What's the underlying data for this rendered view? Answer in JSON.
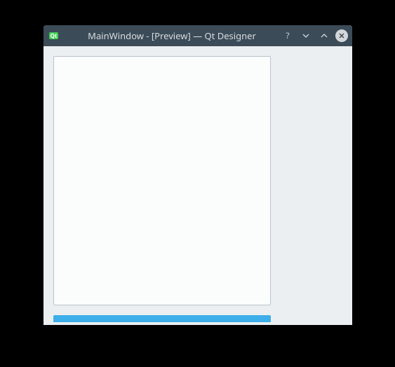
{
  "window": {
    "title": "MainWindow - [Preview] — Qt Designer"
  },
  "icons": {
    "app": "qt-logo",
    "help": "?",
    "minimize": "chevron-down",
    "maximize": "chevron-up",
    "close": "x"
  },
  "colors": {
    "titlebar_bg": "#3b4b57",
    "content_bg": "#eceff1",
    "widget_bg": "#fbfcfc",
    "button_bg": "#3daee9",
    "border": "#b8c4cc"
  }
}
